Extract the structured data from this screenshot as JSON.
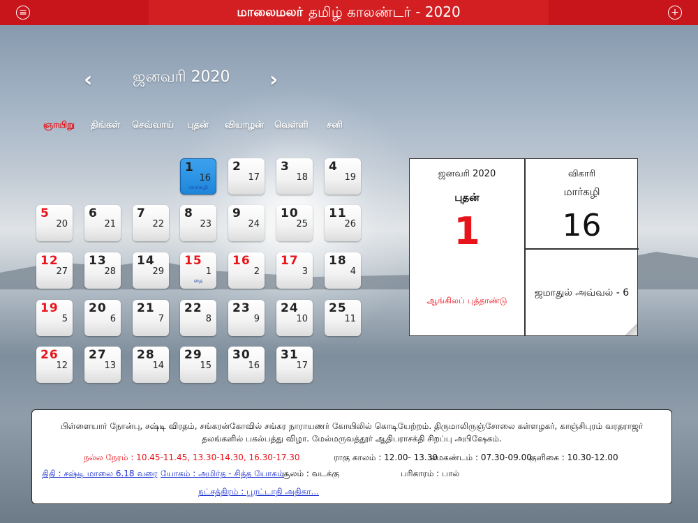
{
  "header": {
    "brand": "மாலைமலர்",
    "title": "தமிழ் காலண்டர் - 2020"
  },
  "nav": {
    "month_title": "ஜனவரி 2020"
  },
  "weekdays": [
    "ஞாயிறு",
    "திங்கள்",
    "செவ்வாய்",
    "புதன்",
    "வியாழன்",
    "வெள்ளி",
    "சனி"
  ],
  "colors": {
    "header_red": "#c8151b",
    "holiday_red": "#e8141b",
    "selected_blue": "#1f85d9",
    "link_blue": "#1a2fd0"
  },
  "days": [
    {
      "g": "1",
      "t": "16",
      "m": "மார்கழி",
      "selected": true
    },
    {
      "g": "2",
      "t": "17"
    },
    {
      "g": "3",
      "t": "18"
    },
    {
      "g": "4",
      "t": "19"
    },
    {
      "g": "5",
      "t": "20",
      "red": true
    },
    {
      "g": "6",
      "t": "21"
    },
    {
      "g": "7",
      "t": "22"
    },
    {
      "g": "8",
      "t": "23"
    },
    {
      "g": "9",
      "t": "24"
    },
    {
      "g": "10",
      "t": "25"
    },
    {
      "g": "11",
      "t": "26"
    },
    {
      "g": "12",
      "t": "27",
      "red": true
    },
    {
      "g": "13",
      "t": "28"
    },
    {
      "g": "14",
      "t": "29"
    },
    {
      "g": "15",
      "t": "1",
      "m": "தை",
      "red": true
    },
    {
      "g": "16",
      "t": "2",
      "red": true
    },
    {
      "g": "17",
      "t": "3",
      "red": true
    },
    {
      "g": "18",
      "t": "4"
    },
    {
      "g": "19",
      "t": "5",
      "red": true
    },
    {
      "g": "20",
      "t": "6"
    },
    {
      "g": "21",
      "t": "7"
    },
    {
      "g": "22",
      "t": "8"
    },
    {
      "g": "23",
      "t": "9"
    },
    {
      "g": "24",
      "t": "10"
    },
    {
      "g": "25",
      "t": "11"
    },
    {
      "g": "26",
      "t": "12",
      "red": true
    },
    {
      "g": "27",
      "t": "13"
    },
    {
      "g": "28",
      "t": "14"
    },
    {
      "g": "29",
      "t": "15"
    },
    {
      "g": "30",
      "t": "16"
    },
    {
      "g": "31",
      "t": "17"
    }
  ],
  "detail": {
    "eng_month": "ஜனவரி 2020",
    "weekday": "புதன்",
    "eng_day": "1",
    "eng_note": "ஆங்கிலப் புத்தாண்டு",
    "tamil_year": "விகாரி",
    "tamil_month": "மார்கழி",
    "tamil_day": "16",
    "islamic": "ஜமாதுல் அவ்வல் - 6"
  },
  "info": {
    "description": "பிள்ளையார் நோன்பு, சஷ்டி விரதம், சங்கரன்கோவில் சங்கர நாராயணர் கோயிலில் கொடியேற்றம். திருமாலிருஞ்சோலை கள்ளழகர், காஞ்சிபுரம் வரதராஜர் தலங்களில் பகல்பத்து விழா. மேல்மருவத்தூர் ஆதிபராசக்தி சிறப்பு அபிஷேகம்.",
    "nalla_neram": "நல்ல நேரம் : 10.45-11.45, 13.30-14.30, 16.30-17.30",
    "ragu": "ராகு காலம் : 12.00- 13.30",
    "emagandam": "எமகண்டம் : 07.30-09.00",
    "kuligai": "குளிகை : 10.30-12.00",
    "thithi": "திதி : சஷ்டி மாலை 6.18 வரை",
    "yogam": "யோகம் : அமிர்த - சித்த யோகம்",
    "soolam": "சூலம் : வடக்கு",
    "pariharam": "பரிகாரம் : பால்",
    "natchathiram": "நட்சத்திரம் : பூரட்டாதி அதிகா..."
  }
}
